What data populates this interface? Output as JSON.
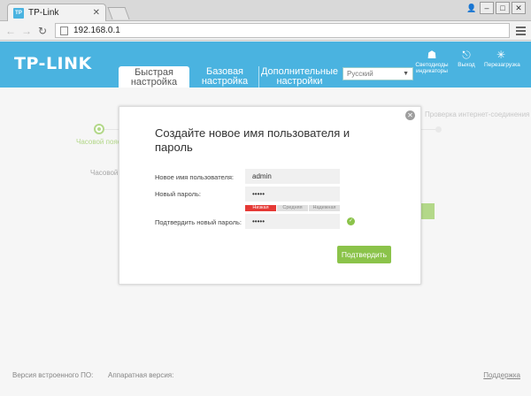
{
  "browser": {
    "tab_title": "TP-Link",
    "favicon_text": "TP",
    "url": "192.168.0.1",
    "user_glyph": "👤",
    "minimize": "–",
    "maximize": "□",
    "close": "✕"
  },
  "header": {
    "logo": "TP-LINK",
    "tabs": [
      {
        "label": "Быстрая настройка",
        "active": true
      },
      {
        "label": "Базовая настройка",
        "active": false
      },
      {
        "label": "Дополнительные настройки",
        "active": false
      }
    ],
    "language": "Русский",
    "icons": [
      {
        "label": "Светодиоды индикаторы",
        "icon": "led-icon"
      },
      {
        "label": "Выход",
        "icon": "logout-icon"
      },
      {
        "label": "Перезагрузка",
        "icon": "reboot-icon"
      }
    ]
  },
  "wizard": {
    "step_current": "Часовой пояс",
    "step_right": "Проверка интернет-соединения",
    "timezone_label": "Часовой",
    "accent": "#8bc34a"
  },
  "modal": {
    "title": "Создайте новое имя пользователя и пароль",
    "fields": {
      "username_label": "Новое имя пользователя:",
      "username_value": "admin",
      "password_label": "Новый пароль:",
      "password_value": "•••••",
      "confirm_label": "Подтвердить новый пароль:",
      "confirm_value": "•••••"
    },
    "strength": {
      "weak": "Низкая",
      "medium": "Средняя",
      "strong": "Надежная"
    },
    "confirm_button": "Подтвердить"
  },
  "footer": {
    "firmware": "Версия встроенного ПО:",
    "hardware": "Аппаратная версия:",
    "support": "Поддержка"
  },
  "colors": {
    "brand": "#4ab3e0",
    "green": "#8bc34a",
    "weak": "#e53935"
  }
}
